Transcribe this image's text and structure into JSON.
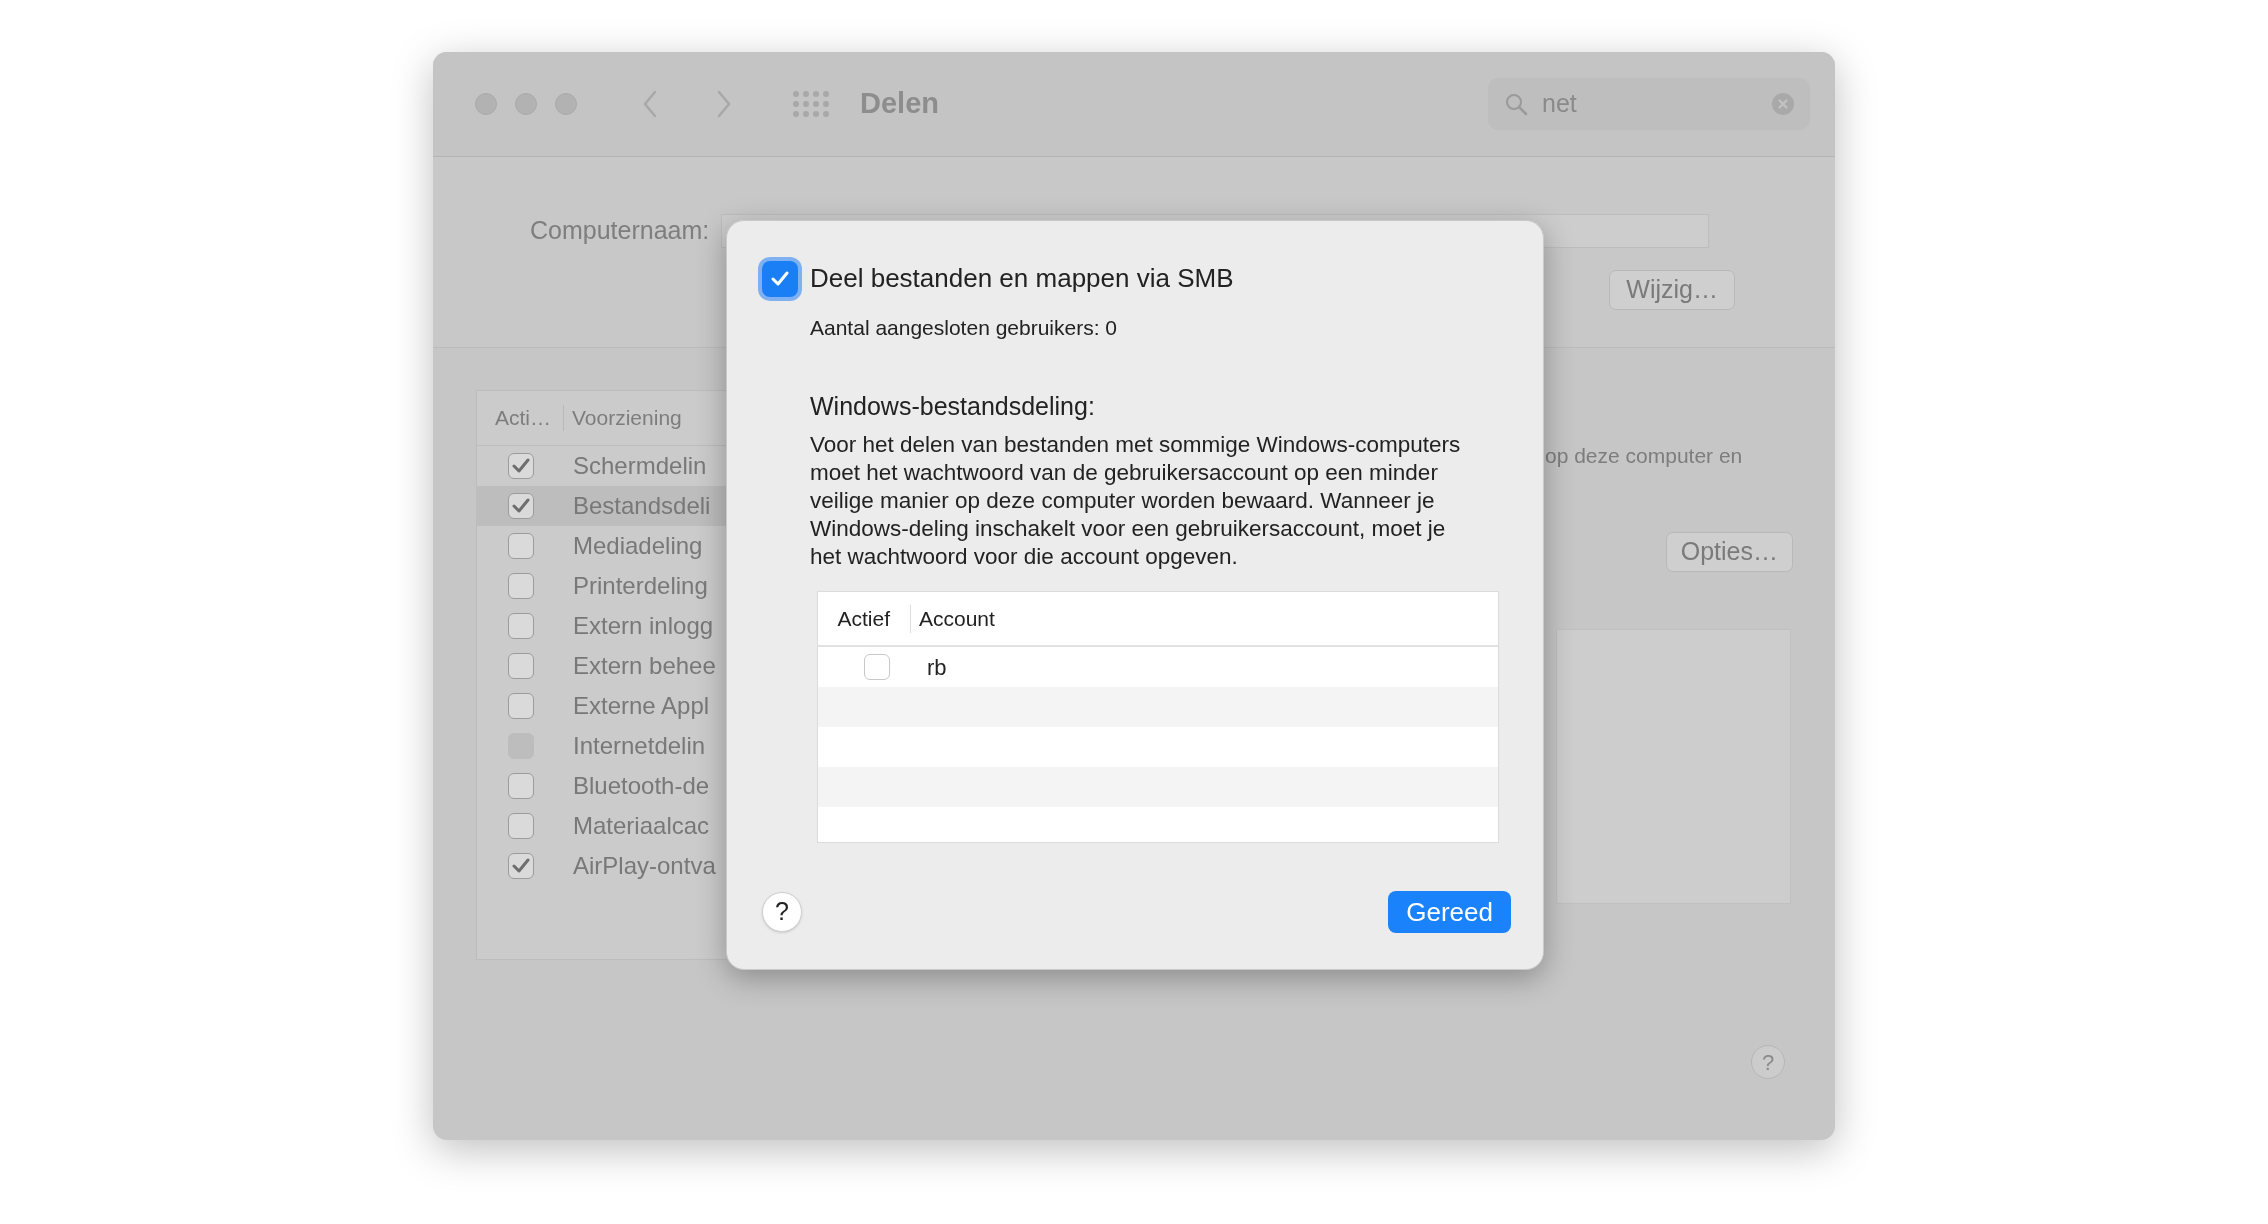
{
  "window": {
    "title": "Delen",
    "search": {
      "value": "net"
    }
  },
  "computer_name": {
    "label": "Computernaam:",
    "button": "Wijzig…"
  },
  "services": {
    "columns": [
      "Acti…",
      "Voorziening"
    ],
    "rows": [
      {
        "label": "Schermdelin",
        "checked": true,
        "selected": false,
        "disabled": false
      },
      {
        "label": "Bestandsdeli",
        "checked": true,
        "selected": true,
        "disabled": false
      },
      {
        "label": "Mediadeling",
        "checked": false,
        "selected": false,
        "disabled": false
      },
      {
        "label": "Printerdeling",
        "checked": false,
        "selected": false,
        "disabled": false
      },
      {
        "label": "Extern inlogg",
        "checked": false,
        "selected": false,
        "disabled": false
      },
      {
        "label": "Extern behee",
        "checked": false,
        "selected": false,
        "disabled": false
      },
      {
        "label": "Externe Appl",
        "checked": false,
        "selected": false,
        "disabled": false
      },
      {
        "label": "Internetdelin",
        "checked": false,
        "selected": false,
        "disabled": true
      },
      {
        "label": "Bluetooth-de",
        "checked": false,
        "selected": false,
        "disabled": false
      },
      {
        "label": "Materiaalcac",
        "checked": false,
        "selected": false,
        "disabled": false
      },
      {
        "label": "AirPlay-ontva",
        "checked": true,
        "selected": false,
        "disabled": false
      }
    ]
  },
  "service_detail": {
    "text": "op deze computer en",
    "button": "Opties…"
  },
  "help_button": "?",
  "dialog": {
    "smb": {
      "label": "Deel bestanden en mappen via SMB",
      "checked": true
    },
    "connected": "Aantal aangesloten gebruikers: 0",
    "windows_heading": "Windows-bestandsdeling:",
    "windows_text": "Voor het delen van bestanden met sommige Windows-computers moet het wachtwoord van de gebruikersaccount op een minder veilige manier op deze computer worden bewaard. Wanneer je Windows-deling inschakelt voor een gebruikersaccount, moet je het wachtwoord voor die account opgeven.",
    "accounts": {
      "columns": [
        "Actief",
        "Account"
      ],
      "rows": [
        {
          "checked": false,
          "account": "rb"
        }
      ]
    },
    "help_button": "?",
    "done_button": "Gereed"
  }
}
